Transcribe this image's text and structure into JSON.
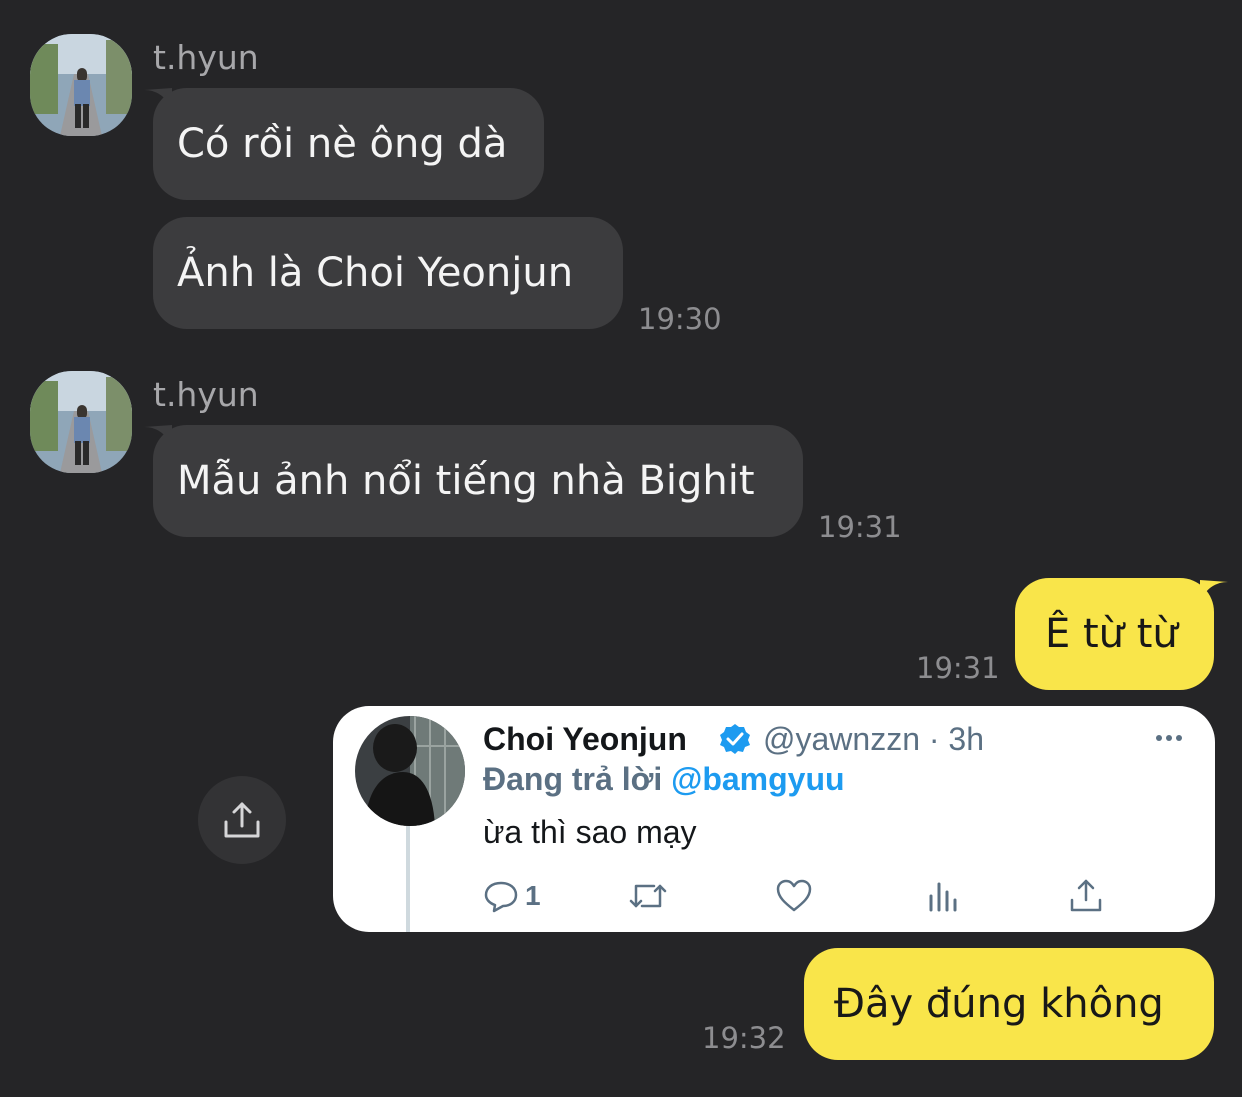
{
  "messages": [
    {
      "sender": "t.hyun",
      "bubbles": [
        "Có rồi nè ông dà",
        "Ảnh là Choi Yeonjun"
      ],
      "time": "19:30"
    },
    {
      "sender": "t.hyun",
      "bubbles": [
        "Mẫu ảnh nổi tiếng nhà Bighit"
      ],
      "time": "19:31"
    }
  ],
  "outgoing": [
    {
      "text": "Ê từ từ",
      "time": "19:31"
    },
    {
      "text": "Đây đúng không",
      "time": "19:32"
    }
  ],
  "tweet": {
    "name": "Choi Yeonjun",
    "handle_time": "@yawnzzn · 3h",
    "reply_prefix": "Đang trả lời",
    "reply_to": "@bamgyuu",
    "text": "ừa thì sao mạy",
    "reply_count": "1",
    "verified_color": "#1d9bf0"
  },
  "colors": {
    "background": "#252527",
    "incoming_bubble": "#3c3c3e",
    "outgoing_bubble": "#f9e54a"
  },
  "icons": {
    "share_button": "share-icon",
    "tweet_actions": [
      "reply-icon",
      "retweet-icon",
      "like-icon",
      "analytics-icon",
      "share-icon"
    ]
  }
}
